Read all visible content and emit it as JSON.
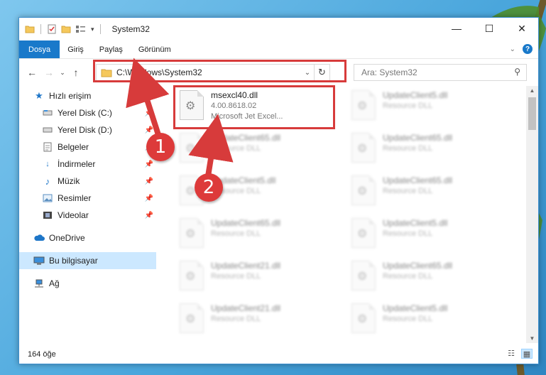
{
  "window": {
    "title": "System32"
  },
  "ribbon": {
    "tabs": [
      "Dosya",
      "Giriş",
      "Paylaş",
      "Görünüm"
    ]
  },
  "address": {
    "path": "C:\\Windows\\System32",
    "search_placeholder": "Ara: System32"
  },
  "nav": {
    "items": [
      {
        "label": "Hızlı erişim",
        "icon": "star-icon",
        "pinned": false
      },
      {
        "label": "Yerel Disk (C:)",
        "icon": "drive-icon",
        "pinned": true
      },
      {
        "label": "Yerel Disk (D:)",
        "icon": "drive-icon",
        "pinned": true
      },
      {
        "label": "Belgeler",
        "icon": "documents-icon",
        "pinned": true
      },
      {
        "label": "İndirmeler",
        "icon": "download-icon",
        "pinned": true
      },
      {
        "label": "Müzik",
        "icon": "music-icon",
        "pinned": true
      },
      {
        "label": "Resimler",
        "icon": "pictures-icon",
        "pinned": true
      },
      {
        "label": "Videolar",
        "icon": "video-icon",
        "pinned": true
      },
      {
        "label": "OneDrive",
        "icon": "cloud-icon",
        "pinned": false
      },
      {
        "label": "Bu bilgisayar",
        "icon": "computer-icon",
        "pinned": false,
        "selected": true
      },
      {
        "label": "Ağ",
        "icon": "network-icon",
        "pinned": false
      }
    ]
  },
  "files": {
    "highlighted": {
      "name": "msexcl40.dll",
      "version": "4.00.8618.02",
      "description": "Microsoft Jet Excel..."
    },
    "others": [
      {
        "name": "UpdateClient5.dll",
        "type": "Resource DLL"
      },
      {
        "name": "UpdateClient65.dll",
        "type": "Resource DLL"
      },
      {
        "name": "UpdateClient65.dll",
        "type": "Resource DLL"
      },
      {
        "name": "UpdateClient5.dll",
        "type": "Resource DLL"
      },
      {
        "name": "UpdateClient65.dll",
        "type": "Resource DLL"
      },
      {
        "name": "UpdateClient65.dll",
        "type": "Resource DLL"
      },
      {
        "name": "UpdateClient5.dll",
        "type": "Resource DLL"
      },
      {
        "name": "UpdateClient21.dll",
        "type": "Resource DLL"
      },
      {
        "name": "UpdateClient65.dll",
        "type": "Resource DLL"
      },
      {
        "name": "UpdateClient21.dll",
        "type": "Resource DLL"
      },
      {
        "name": "UpdateClient5.dll",
        "type": "Resource DLL"
      }
    ]
  },
  "status": {
    "count": "164 öğe"
  },
  "annotations": {
    "badge1": "1",
    "badge2": "2"
  },
  "colors": {
    "accent": "#1979ca",
    "annotation": "#d73b3b",
    "selection": "#cce8ff"
  }
}
